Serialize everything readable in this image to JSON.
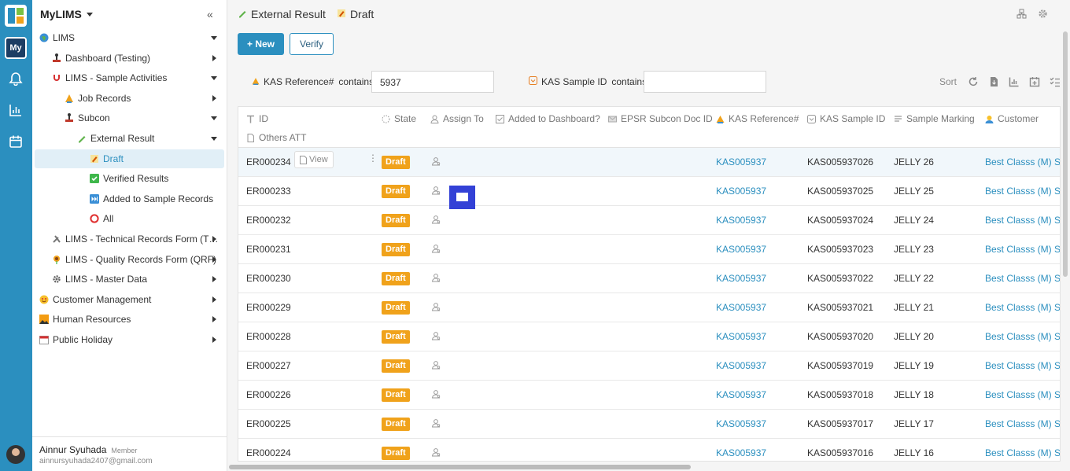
{
  "app": {
    "name": "MyLIMS",
    "rail_badge": "My"
  },
  "sidebar": {
    "collapse_glyph": "«",
    "items": [
      {
        "label": "LIMS",
        "icon": "globe-icon"
      },
      {
        "label": "Dashboard (Testing)",
        "icon": "stamp-icon"
      },
      {
        "label": "LIMS - Sample Activities",
        "icon": "magnet-icon"
      },
      {
        "label": "Job Records",
        "icon": "triangle-icon"
      },
      {
        "label": "Subcon",
        "icon": "stamp-icon"
      },
      {
        "label": "External Result",
        "icon": "pencil-icon"
      },
      {
        "label": "Draft",
        "icon": "memo-icon"
      },
      {
        "label": "Verified Results",
        "icon": "check-icon"
      },
      {
        "label": "Added to Sample Records",
        "icon": "skip-icon"
      },
      {
        "label": "All",
        "icon": "circle-icon"
      },
      {
        "label": "LIMS - Technical Records Form (T…",
        "icon": "tools-icon"
      },
      {
        "label": "LIMS - Quality Records Form (QRF)",
        "icon": "flower-icon"
      },
      {
        "label": "LIMS - Master Data",
        "icon": "gear-icon"
      },
      {
        "label": "Customer Management",
        "icon": "face-icon"
      },
      {
        "label": "Human Resources",
        "icon": "photo-icon"
      },
      {
        "label": "Public Holiday",
        "icon": "calendar-icon"
      }
    ]
  },
  "user": {
    "name": "Ainnur Syuhada",
    "role": "Member",
    "email": "ainnursyuhada2407@gmail.com"
  },
  "header": {
    "crumb1": "External Result",
    "crumb2": "Draft"
  },
  "toolbar": {
    "new_label": "+ New",
    "verify_label": "Verify"
  },
  "filters": {
    "f1_label": "KAS Reference#",
    "f1_op": "contains",
    "f1_value": "5937",
    "f2_label": "KAS Sample ID",
    "f2_op": "contains",
    "f2_value": "",
    "sort_label": "Sort"
  },
  "columns": {
    "id": "ID",
    "state": "State",
    "assign": "Assign To",
    "added": "Added to Dashboard?",
    "epsr": "EPSR Subcon Doc ID",
    "kasref": "KAS Reference#",
    "kassample": "KAS Sample ID",
    "marking": "Sample Marking",
    "customer": "Customer",
    "others": "Others ATT"
  },
  "row_view_label": "View",
  "rows": [
    {
      "id": "ER000234",
      "state": "Draft",
      "kasref": "KAS005937",
      "kassample": "KAS005937026",
      "marking": "JELLY 26",
      "customer": "Best Classs (M) Sd"
    },
    {
      "id": "ER000233",
      "state": "Draft",
      "kasref": "KAS005937",
      "kassample": "KAS005937025",
      "marking": "JELLY 25",
      "customer": "Best Classs (M) Sd"
    },
    {
      "id": "ER000232",
      "state": "Draft",
      "kasref": "KAS005937",
      "kassample": "KAS005937024",
      "marking": "JELLY 24",
      "customer": "Best Classs (M) Sd"
    },
    {
      "id": "ER000231",
      "state": "Draft",
      "kasref": "KAS005937",
      "kassample": "KAS005937023",
      "marking": "JELLY 23",
      "customer": "Best Classs (M) Sd"
    },
    {
      "id": "ER000230",
      "state": "Draft",
      "kasref": "KAS005937",
      "kassample": "KAS005937022",
      "marking": "JELLY 22",
      "customer": "Best Classs (M) Sd"
    },
    {
      "id": "ER000229",
      "state": "Draft",
      "kasref": "KAS005937",
      "kassample": "KAS005937021",
      "marking": "JELLY 21",
      "customer": "Best Classs (M) Sd"
    },
    {
      "id": "ER000228",
      "state": "Draft",
      "kasref": "KAS005937",
      "kassample": "KAS005937020",
      "marking": "JELLY 20",
      "customer": "Best Classs (M) Sd"
    },
    {
      "id": "ER000227",
      "state": "Draft",
      "kasref": "KAS005937",
      "kassample": "KAS005937019",
      "marking": "JELLY 19",
      "customer": "Best Classs (M) Sd"
    },
    {
      "id": "ER000226",
      "state": "Draft",
      "kasref": "KAS005937",
      "kassample": "KAS005937018",
      "marking": "JELLY 18",
      "customer": "Best Classs (M) Sd"
    },
    {
      "id": "ER000225",
      "state": "Draft",
      "kasref": "KAS005937",
      "kassample": "KAS005937017",
      "marking": "JELLY 17",
      "customer": "Best Classs (M) Sd"
    },
    {
      "id": "ER000224",
      "state": "Draft",
      "kasref": "KAS005937",
      "kassample": "KAS005937016",
      "marking": "JELLY 16",
      "customer": "Best Classs (M) Sd"
    }
  ],
  "colors": {
    "accent": "#2b8fbf",
    "badge": "#f0a21b"
  }
}
